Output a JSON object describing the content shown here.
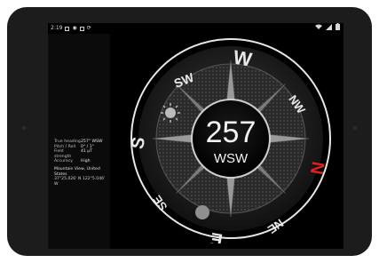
{
  "status_bar": {
    "time": "2:19",
    "left_icons": [
      "sim-icon",
      "location-icon",
      "screenshot-icon",
      "sync-icon"
    ],
    "right_icons": [
      "wifi-icon",
      "signal-icon",
      "battery-icon"
    ]
  },
  "info_panel": {
    "rows": [
      {
        "label": "True heading",
        "value": "257° WSW"
      },
      {
        "label": "Pitch / Roll",
        "value": "0° / 1°"
      },
      {
        "label": "Field strength",
        "value": "41 µT"
      },
      {
        "label": "Accuracy",
        "value": "High"
      }
    ],
    "location": "Mountain View, United States",
    "coordinates": "37°25.026' N 122°5.046' W"
  },
  "compass": {
    "heading_degrees": "257",
    "heading_direction": "WSW",
    "cardinal_labels": {
      "N": "N",
      "NE": "NE",
      "E": "E",
      "SE": "SE",
      "S": "S",
      "SW": "SW",
      "W": "W",
      "NW": "NW"
    },
    "north_color": "#e02020",
    "label_color": "#e8e8e8",
    "sun_icon": "sun-icon",
    "moon_icon": "moon-icon"
  }
}
